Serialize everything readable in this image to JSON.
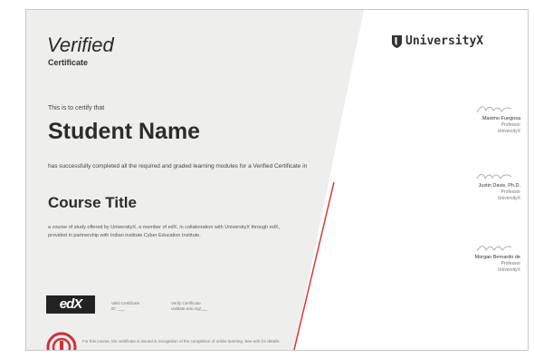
{
  "certificate": {
    "verified_title": "Verified",
    "verified_subtitle": "Certificate",
    "intro": "This is to certify that",
    "student_name": "Student Name",
    "completed_text": "has successfully completed all the required and graded learning modules for a Verified Certificate in",
    "course_title": "Course Title",
    "course_description": "a course of study offered by UniversityX, a member of edX, in collaboration with UniversityX through edX, provided in partnership with Indian institute Cyber Education Institute."
  },
  "footer": {
    "edx_logo_text": "edX",
    "reference_label": "Valid Certificate",
    "reference_value": "ID: ___",
    "verify_label": "Verify Certificate",
    "verify_value": "validate.edx.org/___",
    "seal_caption": "",
    "footnote": "For this course, the certificate is issued in recognition of the completion of online learning. See edX for details."
  },
  "brand": {
    "icon": "shield-icon",
    "name": "UniversityX"
  },
  "signatories": [
    {
      "name": "Maximo Fuegosa",
      "role": "Professor",
      "org": "UniversityX"
    },
    {
      "name": "Justin Davis, Ph.D.",
      "role": "Professor",
      "org": "UniversityX"
    },
    {
      "name": "Morgan Bernardo de",
      "role": "Professor",
      "org": "UniversityX"
    }
  ],
  "colors": {
    "left_panel": "#eeeeec",
    "accent_line": "#d9383a",
    "seal": "#cf2f3a",
    "brand_text": "#333333"
  }
}
